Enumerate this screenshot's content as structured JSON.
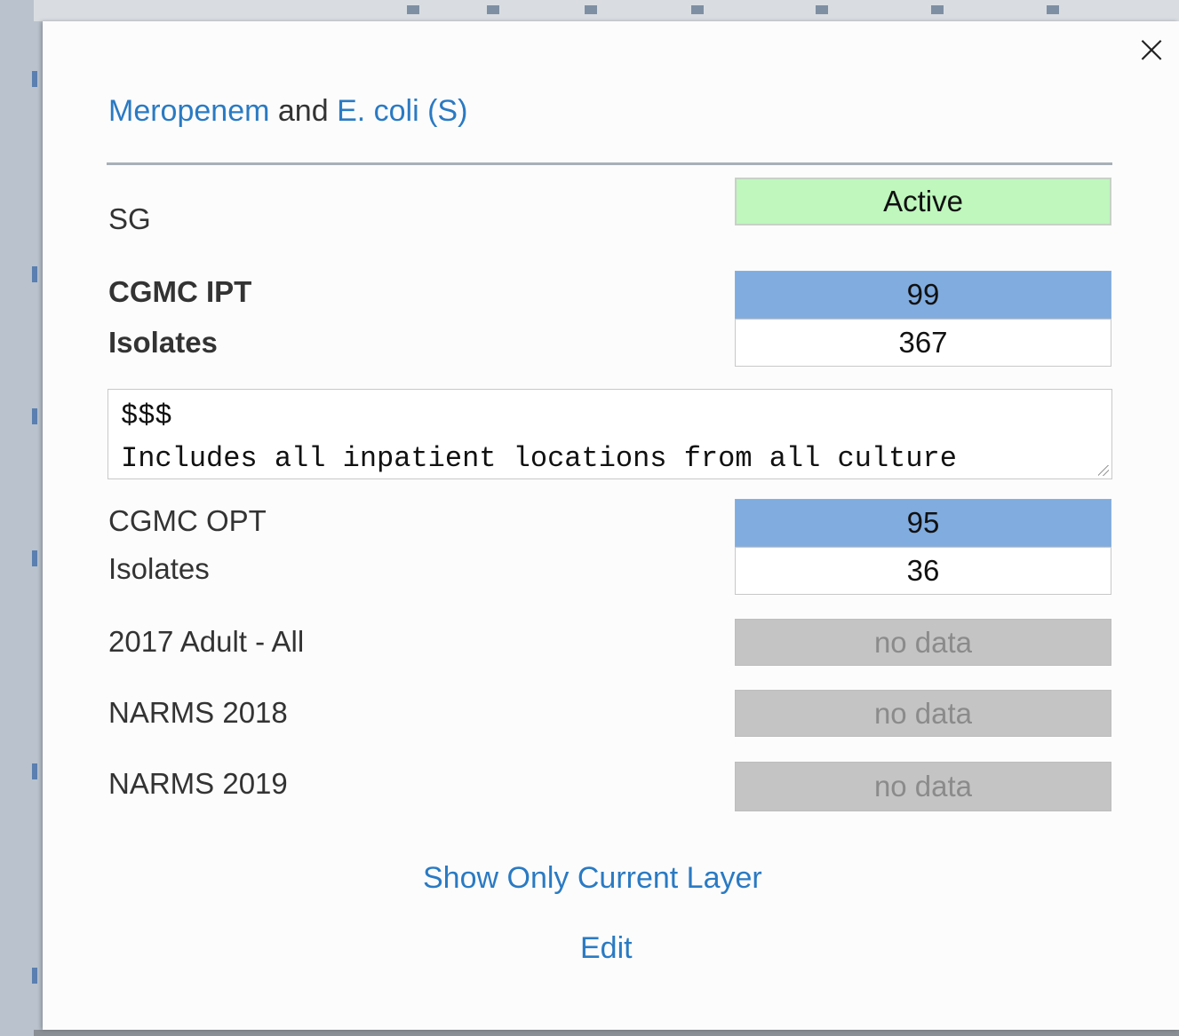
{
  "dialog": {
    "close_symbol": "×",
    "title": {
      "drug": "Meropenem",
      "connector": "and",
      "organism": "E. coli (S)"
    }
  },
  "rows": {
    "sg": {
      "label": "SG",
      "value": "Active",
      "color": "#bff7bd"
    },
    "ipt": {
      "label": "CGMC IPT",
      "score": "99",
      "isolates_label": "Isolates",
      "isolates": "367",
      "notes": "$$$\nIncludes all inpatient locations from all culture"
    },
    "opt": {
      "label": "CGMC OPT",
      "score": "95",
      "isolates_label": "Isolates",
      "isolates": "36"
    },
    "adult_2017": {
      "label": "2017 Adult - All",
      "value": "no data"
    },
    "narms_2018": {
      "label": "NARMS 2018",
      "value": "no data"
    },
    "narms_2019": {
      "label": "NARMS 2019",
      "value": "no data"
    }
  },
  "actions": {
    "show_only_current_layer": "Show Only Current Layer",
    "edit": "Edit"
  },
  "colors": {
    "link": "#2a7ac3",
    "score_fill": "#80acdf",
    "no_data_fill": "#c4c4c4"
  }
}
